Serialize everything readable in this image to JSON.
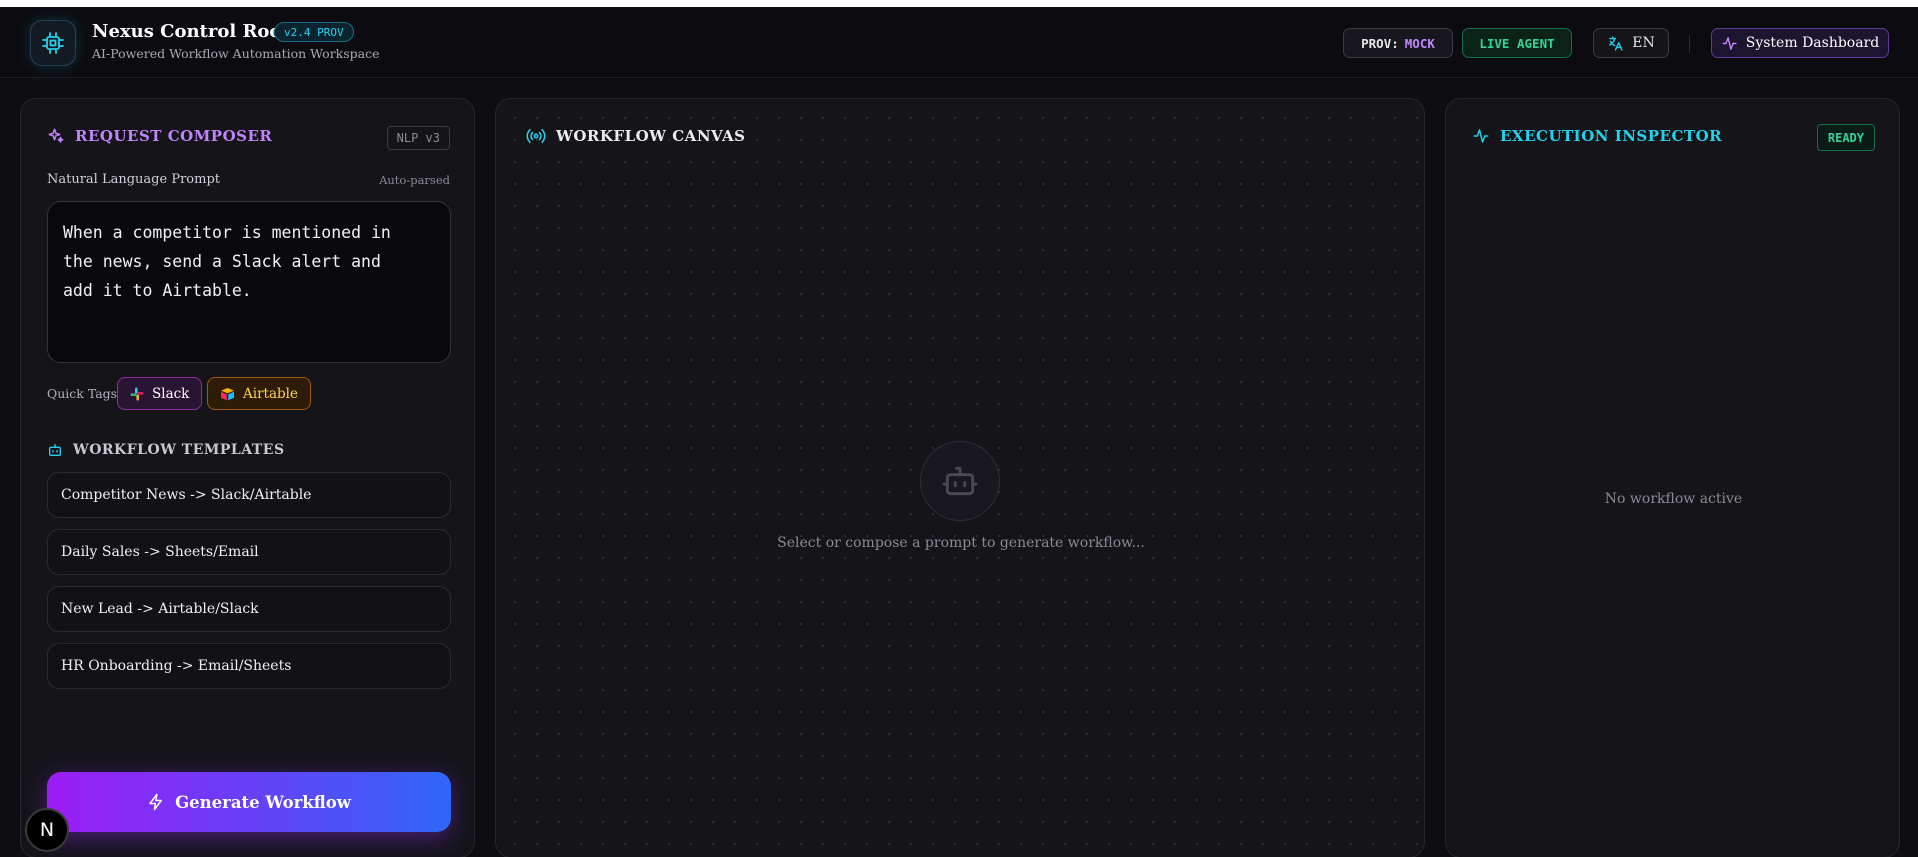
{
  "header": {
    "title": "Nexus Control Room",
    "version": "v2.4 PROV",
    "subtitle": "AI-Powered Workflow Automation Workspace",
    "prov_label": "PROV:",
    "prov_value": "MOCK",
    "live_label": "LIVE AGENT",
    "lang_label": "EN",
    "dashboard_label": "System Dashboard"
  },
  "composer": {
    "title": "REQUEST COMPOSER",
    "badge": "NLP v3",
    "prompt_label": "Natural Language Prompt",
    "auto_parsed": "Auto-parsed",
    "prompt_text": "When a competitor is mentioned in\nthe news, send a Slack alert and\nadd it to Airtable.",
    "quick_tags_label": "Quick Tags:",
    "tags": [
      {
        "label": "Slack"
      },
      {
        "label": "Airtable"
      }
    ],
    "templates_title": "WORKFLOW TEMPLATES",
    "templates": [
      {
        "label": "Competitor News -> Slack/Airtable"
      },
      {
        "label": "Daily Sales -> Sheets/Email"
      },
      {
        "label": "New Lead -> Airtable/Slack"
      },
      {
        "label": "HR Onboarding -> Email/Sheets"
      }
    ],
    "generate_label": "Generate Workflow"
  },
  "canvas": {
    "title": "WORKFLOW CANVAS",
    "empty_hint": "Select or compose a prompt to generate workflow..."
  },
  "inspector": {
    "title": "EXECUTION INSPECTOR",
    "status": "READY",
    "empty_text": "No workflow active"
  },
  "dev_badge": "N",
  "colors": {
    "accent_purple": "#c084fc",
    "accent_cyan": "#22d3ee",
    "accent_green": "#34d399",
    "gradient_start": "#9d1cf5",
    "gradient_end": "#2f66f7"
  },
  "icons": {
    "logo": "cpu-chip-icon",
    "language": "translate-icon",
    "dashboard": "activity-pulse-icon",
    "composer": "sparkles-icon",
    "templates": "bot-icon",
    "canvas": "radio-broadcast-icon",
    "inspector": "activity-pulse-icon",
    "generate": "lightning-bolt-icon"
  }
}
